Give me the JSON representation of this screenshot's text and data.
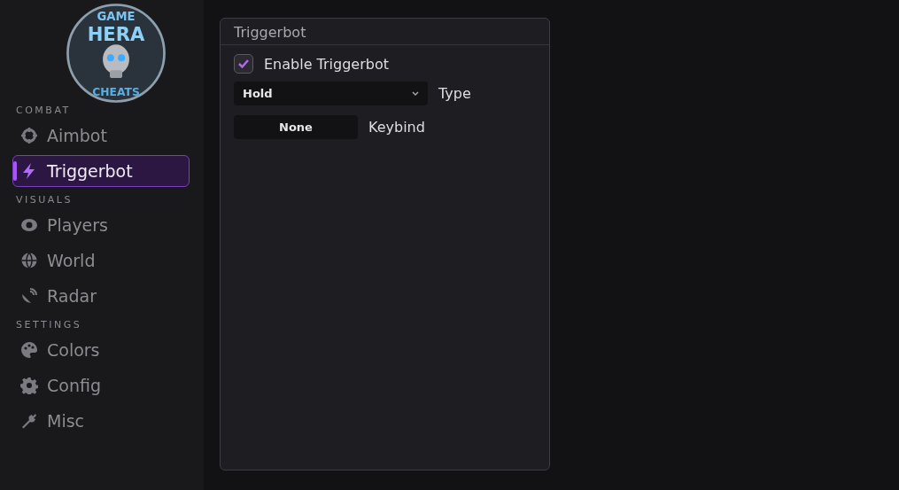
{
  "logo": {
    "top": "GAME",
    "middle": "HERA",
    "bottom": "CHEATS"
  },
  "sidebar": {
    "sections": [
      {
        "label": "COMBAT",
        "items": [
          {
            "label": "Aimbot",
            "selected": false
          },
          {
            "label": "Triggerbot",
            "selected": true
          }
        ]
      },
      {
        "label": "VISUALS",
        "items": [
          {
            "label": "Players",
            "selected": false
          },
          {
            "label": "World",
            "selected": false
          },
          {
            "label": "Radar",
            "selected": false
          }
        ]
      },
      {
        "label": "SETTINGS",
        "items": [
          {
            "label": "Colors",
            "selected": false
          },
          {
            "label": "Config",
            "selected": false
          },
          {
            "label": "Misc",
            "selected": false
          }
        ]
      }
    ]
  },
  "panel": {
    "title": "Triggerbot",
    "enable": {
      "label": "Enable Triggerbot",
      "checked": true
    },
    "type": {
      "value": "Hold",
      "label": "Type"
    },
    "keybind": {
      "value": "None",
      "label": "Keybind"
    }
  }
}
